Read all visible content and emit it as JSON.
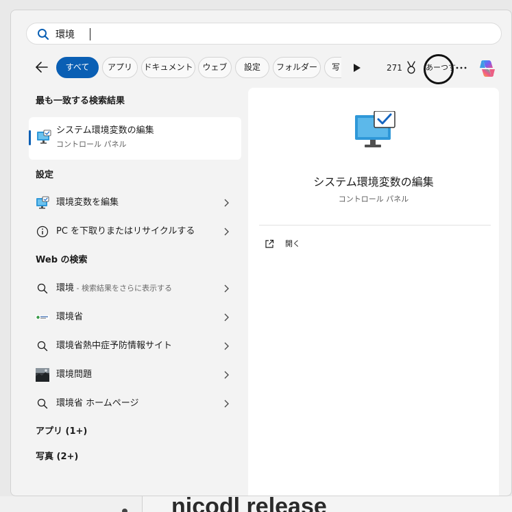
{
  "search": {
    "query": "環境"
  },
  "filters": [
    {
      "label": "すべて",
      "active": true
    },
    {
      "label": "アプリ",
      "active": false
    },
    {
      "label": "ドキュメント",
      "active": false
    },
    {
      "label": "ウェブ",
      "active": false
    },
    {
      "label": "設定",
      "active": false
    },
    {
      "label": "フォルダー",
      "active": false
    },
    {
      "label": "写",
      "active": false
    }
  ],
  "header": {
    "points": "271",
    "avatar_text": "あーつす"
  },
  "best_match": {
    "heading": "最も一致する検索結果",
    "title": "システム環境変数の編集",
    "subtitle": "コントロール パネル"
  },
  "settings_section": {
    "heading": "設定",
    "items": [
      {
        "label": "環境変数を編集",
        "icon": "control-panel-icon"
      },
      {
        "label": "PC を下取りまたはリサイクルする",
        "icon": "info-icon"
      }
    ]
  },
  "web_section": {
    "heading": "Web の検索",
    "items": [
      {
        "label": "環境",
        "hint": " - 検索結果をさらに表示する",
        "icon": "search-icon"
      },
      {
        "label": "環境省",
        "icon": "site-logo-icon"
      },
      {
        "label": "環境省熱中症予防情報サイト",
        "icon": "search-icon"
      },
      {
        "label": "環境問題",
        "icon": "image-thumbnail-icon"
      },
      {
        "label": "環境省 ホームページ",
        "icon": "search-icon"
      }
    ]
  },
  "apps_section": {
    "heading": "アプリ (1+)"
  },
  "photos_section": {
    "heading": "写真 (2+)"
  },
  "preview": {
    "title": "システム環境変数の編集",
    "subtitle": "コントロール パネル",
    "open_label": "開く"
  },
  "background": {
    "text": "nicodl release"
  },
  "colors": {
    "accent": "#0a5fb4",
    "panel": "#f3f3f3",
    "card": "#ffffff",
    "annotation": "#111111"
  }
}
